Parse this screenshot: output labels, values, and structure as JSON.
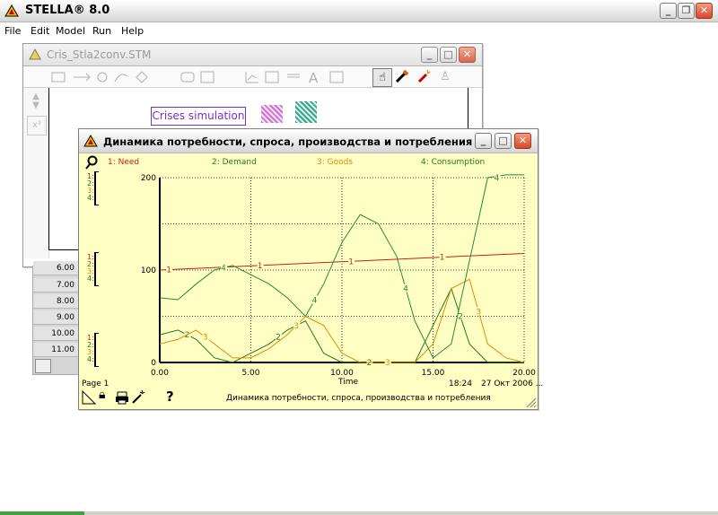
{
  "app": {
    "title": "STELLA® 8.0",
    "menu": [
      "File",
      "Edit",
      "Model",
      "Run",
      "Help"
    ]
  },
  "model_window": {
    "title": "Cris_Stla2conv.STM",
    "label_box": "Crises simulation",
    "table_rows": [
      "6.00",
      "7.00",
      "8.00",
      "9.00",
      "10.00",
      "11.00"
    ]
  },
  "graph_window": {
    "title": "Динамика потребности, спроса, производства и потребления",
    "page_label": "Page 1",
    "footer_time": "18:24",
    "footer_date": "27 Окт 2006 ...",
    "footer_title": "Динамика потребности, спроса, производства и потребления",
    "help_glyph": "?",
    "x_axis_label": "Time",
    "scale_labels": [
      "1:",
      "2:",
      "3:",
      "4:"
    ],
    "icons": [
      "key-icon",
      "lock-icon",
      "print-icon",
      "magic-wand-icon",
      "resize-grip-icon"
    ]
  },
  "chart_data": {
    "type": "line",
    "title": "Динамика потребности, спроса, производства и потребления",
    "xlabel": "Time",
    "ylabel": "",
    "xlim": [
      0,
      20
    ],
    "ylim": [
      0,
      200
    ],
    "x_ticks": [
      "0.00",
      "5.00",
      "10.00",
      "15.00",
      "20.00"
    ],
    "y_ticks": [
      "0",
      "100",
      "200"
    ],
    "grid": true,
    "legend_position": "top",
    "series": [
      {
        "name": "1: Need",
        "marker": "1",
        "color": "#c81e1e",
        "x": [
          0,
          20
        ],
        "y": [
          100,
          118
        ]
      },
      {
        "name": "2: Demand",
        "marker": "2",
        "color": "#1f7a1f",
        "x": [
          0,
          1,
          2,
          3,
          4,
          5,
          6,
          7,
          8,
          9,
          10,
          11,
          12,
          13,
          14,
          15,
          16,
          17,
          18,
          19,
          20
        ],
        "y": [
          30,
          35,
          25,
          5,
          0,
          10,
          20,
          35,
          45,
          10,
          0,
          0,
          0,
          0,
          0,
          40,
          80,
          20,
          0,
          0,
          0
        ]
      },
      {
        "name": "3: Goods",
        "marker": "3",
        "color": "#e08a00",
        "x": [
          0,
          1,
          2,
          3,
          4,
          5,
          6,
          7,
          8,
          9,
          10,
          11,
          12,
          13,
          14,
          15,
          16,
          17,
          18,
          19,
          20
        ],
        "y": [
          20,
          25,
          35,
          20,
          5,
          5,
          15,
          30,
          50,
          40,
          10,
          0,
          0,
          0,
          0,
          20,
          80,
          90,
          20,
          5,
          0
        ]
      },
      {
        "name": "4: Consumption",
        "marker": "4",
        "color": "#1f8a3a",
        "x": [
          0,
          1,
          2,
          3,
          4,
          5,
          6,
          7,
          8,
          9,
          10,
          11,
          12,
          13,
          14,
          15,
          16,
          17,
          18,
          19,
          20
        ],
        "y": [
          70,
          68,
          85,
          100,
          105,
          95,
          85,
          70,
          50,
          85,
          130,
          160,
          150,
          115,
          45,
          5,
          20,
          110,
          200,
          205,
          205
        ]
      }
    ],
    "marker_positions_x": [
      [
        0.5,
        5.5,
        10.5,
        15.5
      ],
      [
        1.5,
        6.5,
        11.5,
        16.5
      ],
      [
        2.5,
        7.5,
        12.5,
        17.5
      ],
      [
        3.5,
        8.5,
        13.5,
        18.5
      ]
    ]
  }
}
